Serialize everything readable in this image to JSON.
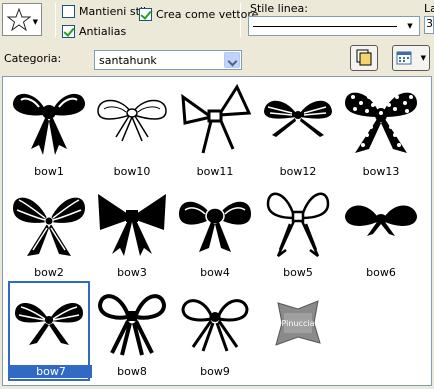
{
  "toolbar": {
    "preset_shape_icon": "star-icon",
    "checkboxes": [
      {
        "label": "Mantieni stile",
        "checked": false
      },
      {
        "label": "Crea come vettore",
        "checked": true
      },
      {
        "label": "Antialias",
        "checked": true
      }
    ],
    "stile_linea_label": "Stile linea:",
    "larghezza_label": "La",
    "larghezza_value": "3"
  },
  "category": {
    "label": "Categoria:",
    "value": "santahunk"
  },
  "gallery": {
    "selected": "bow7",
    "items": [
      {
        "name": "bow1"
      },
      {
        "name": "bow10"
      },
      {
        "name": "bow11"
      },
      {
        "name": "bow12"
      },
      {
        "name": "bow13"
      },
      {
        "name": "bow2"
      },
      {
        "name": "bow3"
      },
      {
        "name": "bow4"
      },
      {
        "name": "bow5"
      },
      {
        "name": "bow6"
      },
      {
        "name": "bow7"
      },
      {
        "name": "bow8"
      },
      {
        "name": "bow9"
      },
      {
        "name": ""
      }
    ],
    "watermark_text": "Pinuccia"
  },
  "colors": {
    "selection": "#316ac5",
    "window_bg": "#ece9d8",
    "checkmark": "#21a121"
  }
}
